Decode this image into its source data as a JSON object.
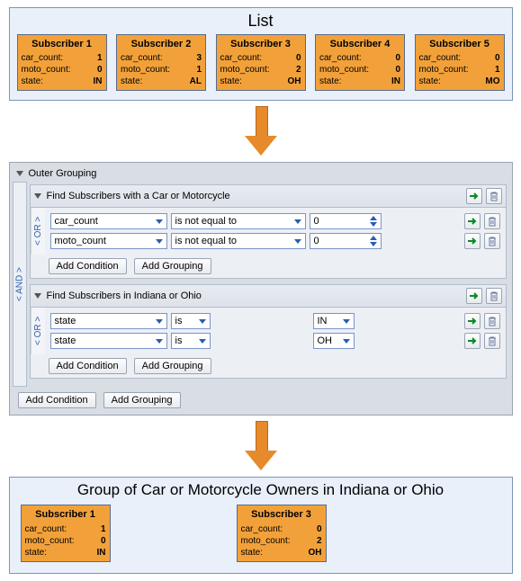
{
  "list": {
    "title": "List",
    "subscribers": [
      {
        "title": "Subscriber 1",
        "car_count": "1",
        "moto_count": "0",
        "state": "IN"
      },
      {
        "title": "Subscriber 2",
        "car_count": "3",
        "moto_count": "1",
        "state": "AL"
      },
      {
        "title": "Subscriber 3",
        "car_count": "0",
        "moto_count": "2",
        "state": "OH"
      },
      {
        "title": "Subscriber 4",
        "car_count": "0",
        "moto_count": "0",
        "state": "IN"
      },
      {
        "title": "Subscriber 5",
        "car_count": "0",
        "moto_count": "1",
        "state": "MO"
      }
    ]
  },
  "labels": {
    "field_car": "car_count:",
    "field_moto": "moto_count:",
    "field_state": "state:"
  },
  "builder": {
    "outer_label": "Outer Grouping",
    "and_label": "< AND >",
    "or_label": "< OR >",
    "add_condition": "Add Condition",
    "add_grouping": "Add Grouping",
    "groups": [
      {
        "title": "Find Subscribers with a Car or Motorcycle",
        "rows": [
          {
            "field": "car_count",
            "op": "is not equal to",
            "val": "0",
            "val_type": "spin"
          },
          {
            "field": "moto_count",
            "op": "is not equal to",
            "val": "0",
            "val_type": "spin"
          }
        ]
      },
      {
        "title": "Find Subscribers in Indiana or Ohio",
        "rows": [
          {
            "field": "state",
            "op": "is",
            "val": "IN",
            "val_type": "select"
          },
          {
            "field": "state",
            "op": "is",
            "val": "OH",
            "val_type": "select"
          }
        ]
      }
    ]
  },
  "result": {
    "title": "Group of Car or Motorcycle Owners in Indiana or Ohio",
    "subscribers": [
      {
        "title": "Subscriber 1",
        "car_count": "1",
        "moto_count": "0",
        "state": "IN"
      },
      {
        "title": "Subscriber 3",
        "car_count": "0",
        "moto_count": "2",
        "state": "OH"
      }
    ]
  }
}
